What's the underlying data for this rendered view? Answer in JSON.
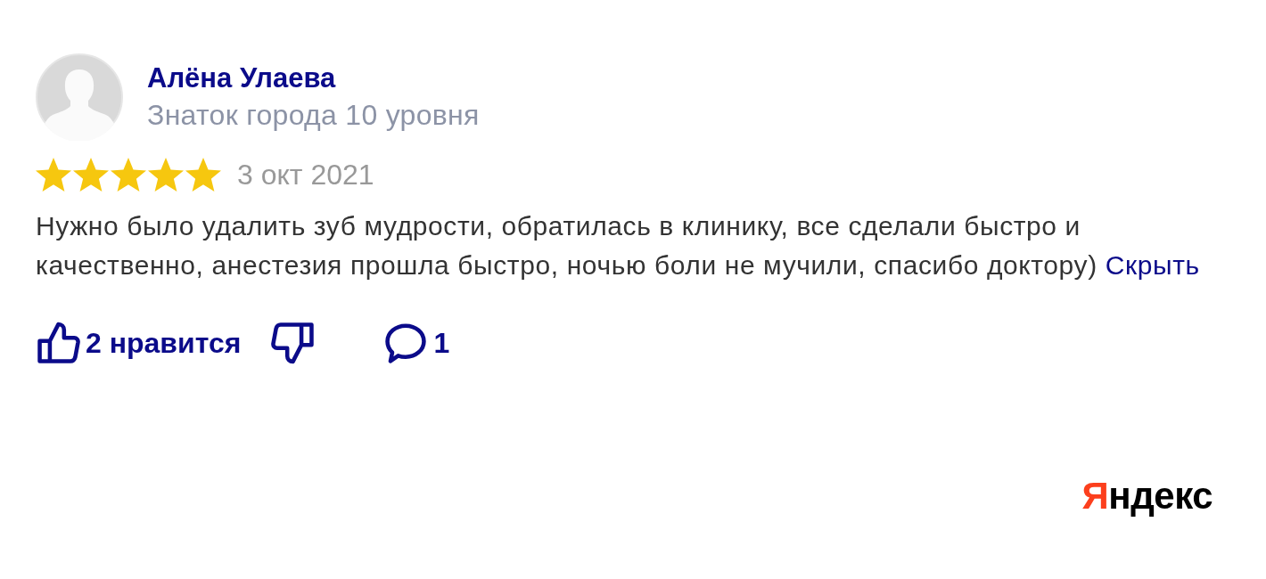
{
  "reviewer": {
    "name": "Алёна Улаева",
    "level": "Знаток города 10 уровня"
  },
  "review": {
    "stars": 5,
    "date": "3 окт 2021",
    "text": "Нужно было удалить зуб мудрости, обратилась в клинику, все сделали быстро и качественно, анестезия прошла быстро, ночью боли не мучили, спасибо доктору)",
    "hide_link": "Скрыть"
  },
  "actions": [
    {
      "kind": "like",
      "label": "2 нравится"
    },
    {
      "kind": "dislike"
    },
    {
      "kind": "comment",
      "label": "1"
    }
  ],
  "logo": "Яндекс"
}
